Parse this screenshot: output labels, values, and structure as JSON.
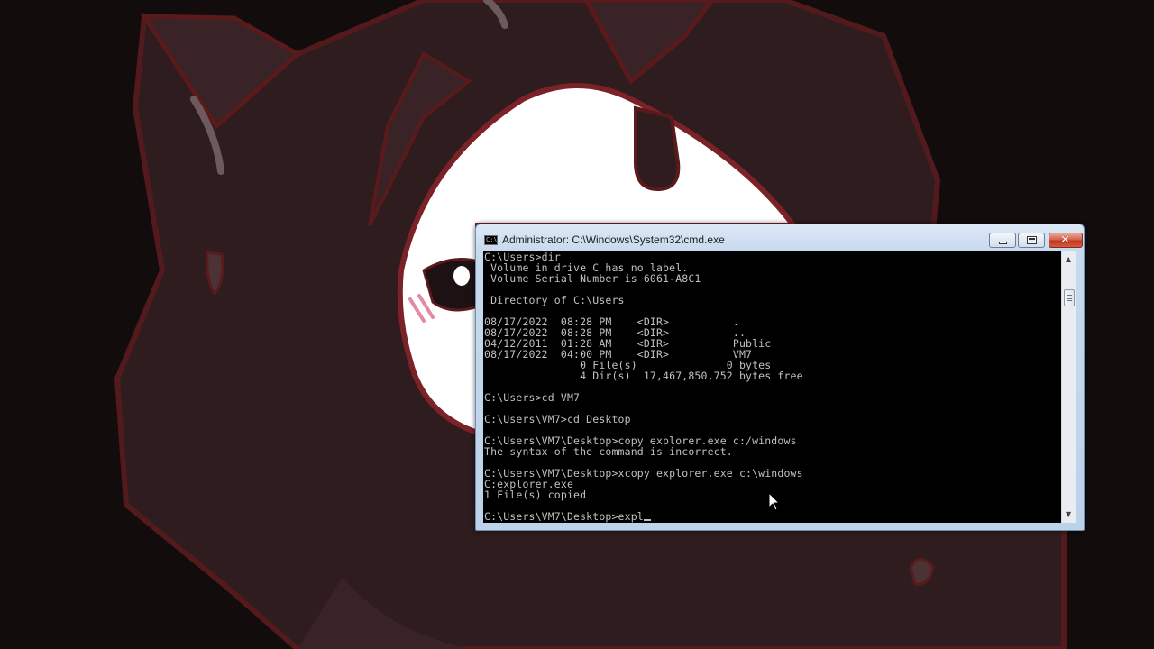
{
  "window": {
    "title": "Administrator: C:\\Windows\\System32\\cmd.exe",
    "icon_label": "C:\\",
    "icon": "cmd-icon",
    "controls": {
      "minimize": "minimize-icon",
      "maximize": "maximize-icon",
      "close": "close-icon",
      "close_glyph": "✕"
    }
  },
  "console": {
    "lines": [
      "C:\\Users>dir",
      " Volume in drive C has no label.",
      " Volume Serial Number is 6061-A8C1",
      "",
      " Directory of C:\\Users",
      "",
      "08/17/2022  08:28 PM    <DIR>          .",
      "08/17/2022  08:28 PM    <DIR>          ..",
      "04/12/2011  01:28 AM    <DIR>          Public",
      "08/17/2022  04:00 PM    <DIR>          VM7",
      "               0 File(s)              0 bytes",
      "               4 Dir(s)  17,467,850,752 bytes free",
      "",
      "C:\\Users>cd VM7",
      "",
      "C:\\Users\\VM7>cd Desktop",
      "",
      "C:\\Users\\VM7\\Desktop>copy explorer.exe c:/windows",
      "The syntax of the command is incorrect.",
      "",
      "C:\\Users\\VM7\\Desktop>xcopy explorer.exe c:\\windows",
      "C:explorer.exe",
      "1 File(s) copied",
      ""
    ],
    "current_input": "C:\\Users\\VM7\\Desktop>expl",
    "text_color": "#c0c0c0",
    "background_color": "#000000"
  },
  "scrollbar": {
    "up_arrow": "▲",
    "down_arrow": "▼"
  },
  "colors": {
    "desktop_background": "#120c0d",
    "wallpaper_dark": "#2e1c1e",
    "wallpaper_outline": "#5a1a1c",
    "wallpaper_light": "#ffffff"
  }
}
